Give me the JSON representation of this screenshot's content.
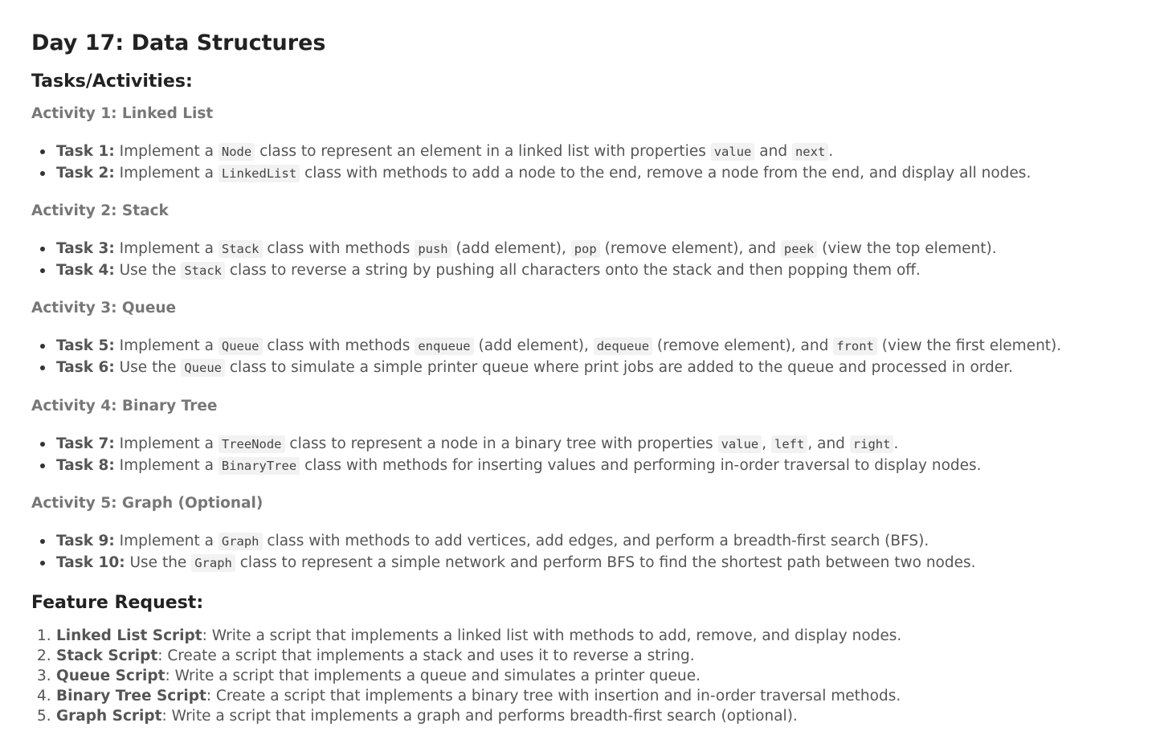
{
  "title": "Day 17: Data Structures",
  "tasks_heading": "Tasks/Activities:",
  "activities": [
    {
      "heading": "Activity 1: Linked List",
      "tasks": [
        {
          "label": "Task 1:",
          "parts": [
            {
              "text": " Implement a "
            },
            {
              "code": "Node"
            },
            {
              "text": " class to represent an element in a linked list with properties "
            },
            {
              "code": "value"
            },
            {
              "text": " and "
            },
            {
              "code": "next"
            },
            {
              "text": "."
            }
          ]
        },
        {
          "label": "Task 2:",
          "parts": [
            {
              "text": " Implement a "
            },
            {
              "code": "LinkedList"
            },
            {
              "text": " class with methods to add a node to the end, remove a node from the end, and display all nodes."
            }
          ]
        }
      ]
    },
    {
      "heading": "Activity 2: Stack",
      "tasks": [
        {
          "label": "Task 3:",
          "parts": [
            {
              "text": " Implement a "
            },
            {
              "code": "Stack"
            },
            {
              "text": " class with methods "
            },
            {
              "code": "push"
            },
            {
              "text": " (add element), "
            },
            {
              "code": "pop"
            },
            {
              "text": " (remove element), and "
            },
            {
              "code": "peek"
            },
            {
              "text": " (view the top element)."
            }
          ]
        },
        {
          "label": "Task 4:",
          "parts": [
            {
              "text": " Use the "
            },
            {
              "code": "Stack"
            },
            {
              "text": " class to reverse a string by pushing all characters onto the stack and then popping them off."
            }
          ]
        }
      ]
    },
    {
      "heading": "Activity 3: Queue",
      "tasks": [
        {
          "label": "Task 5:",
          "parts": [
            {
              "text": " Implement a "
            },
            {
              "code": "Queue"
            },
            {
              "text": " class with methods "
            },
            {
              "code": "enqueue"
            },
            {
              "text": " (add element), "
            },
            {
              "code": "dequeue"
            },
            {
              "text": " (remove element), and "
            },
            {
              "code": "front"
            },
            {
              "text": " (view the first element)."
            }
          ]
        },
        {
          "label": "Task 6:",
          "parts": [
            {
              "text": " Use the "
            },
            {
              "code": "Queue"
            },
            {
              "text": " class to simulate a simple printer queue where print jobs are added to the queue and processed in order."
            }
          ]
        }
      ]
    },
    {
      "heading": "Activity 4: Binary Tree",
      "tasks": [
        {
          "label": "Task 7:",
          "parts": [
            {
              "text": " Implement a "
            },
            {
              "code": "TreeNode"
            },
            {
              "text": " class to represent a node in a binary tree with properties "
            },
            {
              "code": "value"
            },
            {
              "text": ", "
            },
            {
              "code": "left"
            },
            {
              "text": ", and "
            },
            {
              "code": "right"
            },
            {
              "text": "."
            }
          ]
        },
        {
          "label": "Task 8:",
          "parts": [
            {
              "text": " Implement a "
            },
            {
              "code": "BinaryTree"
            },
            {
              "text": " class with methods for inserting values and performing in-order traversal to display nodes."
            }
          ]
        }
      ]
    },
    {
      "heading": "Activity 5: Graph (Optional)",
      "tasks": [
        {
          "label": "Task 9:",
          "parts": [
            {
              "text": " Implement a "
            },
            {
              "code": "Graph"
            },
            {
              "text": " class with methods to add vertices, add edges, and perform a breadth-first search (BFS)."
            }
          ]
        },
        {
          "label": "Task 10:",
          "parts": [
            {
              "text": " Use the "
            },
            {
              "code": "Graph"
            },
            {
              "text": " class to represent a simple network and perform BFS to find the shortest path between two nodes."
            }
          ]
        }
      ]
    }
  ],
  "feature_heading": "Feature Request:",
  "features": [
    {
      "num": "1.",
      "label": "Linked List Script",
      "text": ": Write a script that implements a linked list with methods to add, remove, and display nodes."
    },
    {
      "num": "2.",
      "label": "Stack Script",
      "text": ": Create a script that implements a stack and uses it to reverse a string."
    },
    {
      "num": "3.",
      "label": "Queue Script",
      "text": ": Write a script that implements a queue and simulates a printer queue."
    },
    {
      "num": "4.",
      "label": "Binary Tree Script",
      "text": ": Create a script that implements a binary tree with insertion and in-order traversal methods."
    },
    {
      "num": "5.",
      "label": "Graph Script",
      "text": ": Write a script that implements a graph and performs breadth-first search (optional)."
    }
  ]
}
